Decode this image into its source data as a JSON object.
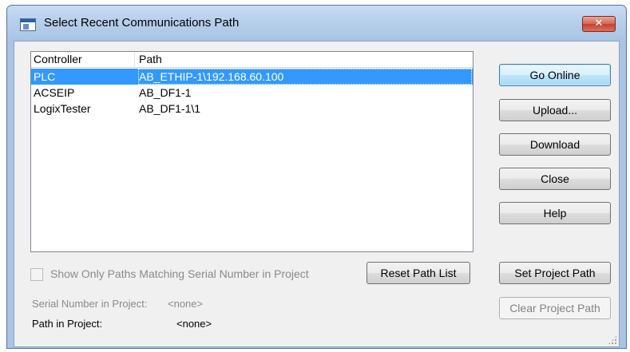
{
  "window": {
    "title": "Select Recent Communications Path",
    "close_glyph": "✕"
  },
  "list": {
    "columns": [
      "Controller",
      "Path"
    ],
    "rows": [
      {
        "controller": "PLC",
        "path": "AB_ETHIP-1\\192.168.60.100",
        "selected": true
      },
      {
        "controller": "ACSEIP",
        "path": "AB_DF1-1",
        "selected": false
      },
      {
        "controller": "LogixTester",
        "path": "AB_DF1-1\\1",
        "selected": false
      }
    ]
  },
  "buttons": {
    "go_online": "Go Online",
    "upload": "Upload...",
    "download": "Download",
    "close": "Close",
    "help": "Help",
    "reset_path_list": "Reset Path List",
    "set_project_path": "Set Project Path",
    "clear_project_path": "Clear Project Path"
  },
  "options": {
    "show_only_matching_label": "Show Only Paths Matching Serial Number in Project",
    "show_only_matching_checked": false
  },
  "info": {
    "serial_label": "Serial Number in Project:",
    "serial_value": "<none>",
    "path_label": "Path in Project:",
    "path_value": "<none>"
  },
  "colors": {
    "selection": "#3399ff",
    "title_bar": "#b7cfeb",
    "close_button": "#c4412d"
  }
}
